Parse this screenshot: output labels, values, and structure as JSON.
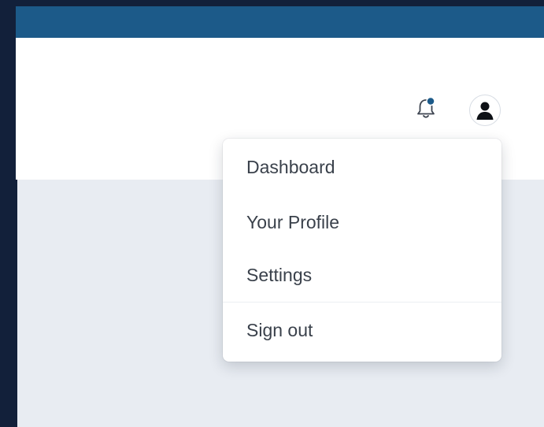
{
  "header": {
    "notification": {
      "icon": "bell-icon",
      "has_unread": true,
      "dot_color": "#1c5a89"
    },
    "user": {
      "icon": "user-avatar-icon"
    }
  },
  "user_menu": {
    "items": [
      {
        "label": "Dashboard"
      },
      {
        "label": "Your Profile"
      },
      {
        "label": "Settings"
      },
      {
        "label": "Sign out"
      }
    ]
  },
  "colors": {
    "topbar": "#1c5a89",
    "page_background": "#e8ecf2",
    "outer_background": "#12203a"
  }
}
